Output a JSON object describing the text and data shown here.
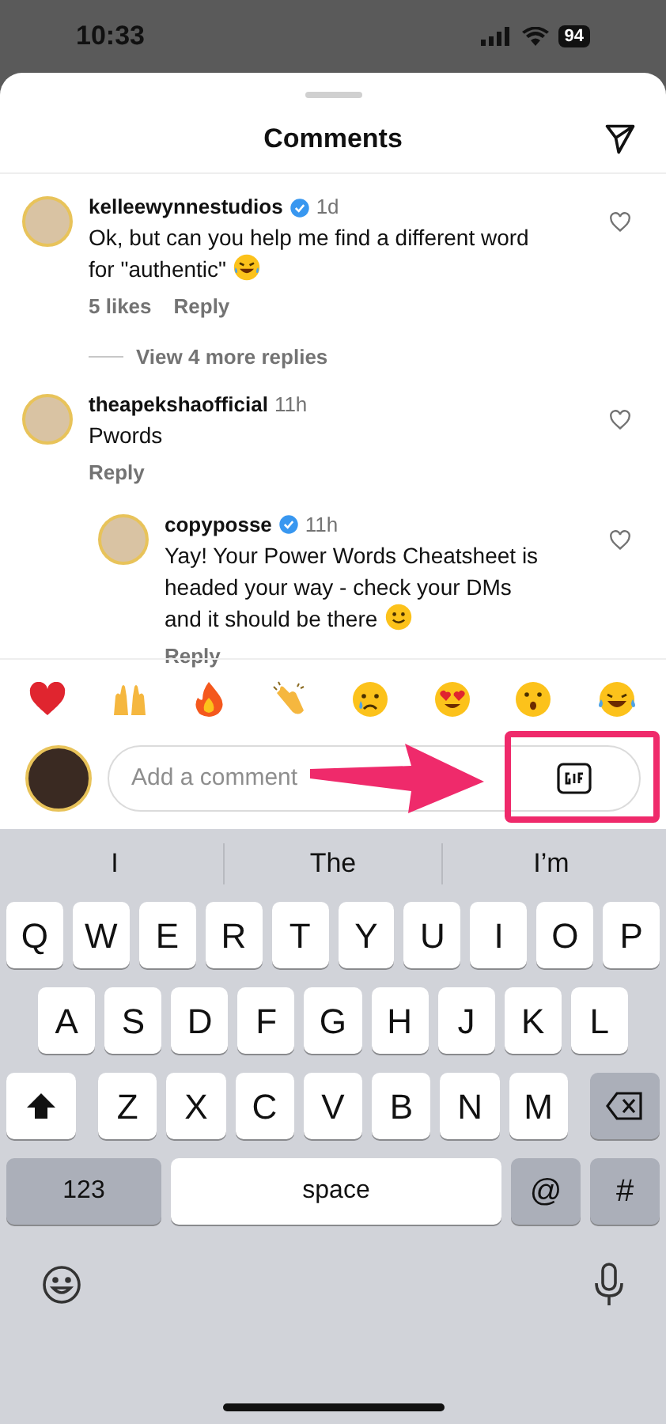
{
  "status_bar": {
    "time": "10:33",
    "battery": "94"
  },
  "header": {
    "title": "Comments"
  },
  "comments": [
    {
      "username": "kelleewynnestudios",
      "verified": true,
      "time": "1d",
      "text": "Ok, but can you help me find a different word for \"authentic\"",
      "kind": "laugh",
      "likes": "5 likes",
      "reply": "Reply",
      "view_replies": "View 4 more replies"
    },
    {
      "username": "theapekshaofficial",
      "verified": false,
      "time": "11h",
      "text": "Pwords",
      "kind": "plain",
      "reply": "Reply",
      "children": [
        {
          "username": "copyposse",
          "verified": true,
          "time": "11h",
          "text": "Yay! Your Power Words Cheatsheet is headed your way - check your DMs and it should be there",
          "kind": "smile",
          "reply": "Reply"
        }
      ]
    }
  ],
  "composer": {
    "placeholder": "Add a comment"
  },
  "keyboard": {
    "suggestions": [
      "I",
      "The",
      "I’m"
    ],
    "rows": [
      [
        "Q",
        "W",
        "E",
        "R",
        "T",
        "Y",
        "U",
        "I",
        "O",
        "P"
      ],
      [
        "A",
        "S",
        "D",
        "F",
        "G",
        "H",
        "J",
        "K",
        "L"
      ],
      [
        "Z",
        "X",
        "C",
        "V",
        "B",
        "N",
        "M"
      ]
    ],
    "bottom": [
      {
        "kind": "mode",
        "label": "123"
      },
      {
        "kind": "space",
        "label": "space"
      },
      {
        "kind": "char",
        "label": "@"
      },
      {
        "kind": "char",
        "label": "#"
      }
    ]
  }
}
